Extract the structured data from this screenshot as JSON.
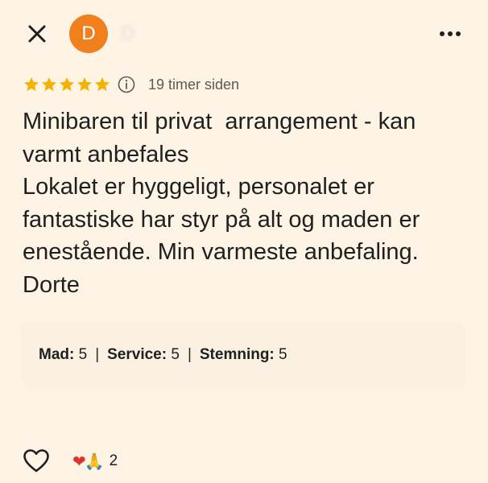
{
  "header": {
    "close_icon": "close-icon",
    "avatar_letter": "D",
    "avatar_color": "#f07f1d",
    "author_name": "D",
    "more_icon": "more-vertical-dots-icon"
  },
  "meta": {
    "rating": 5,
    "rating_max": 5,
    "star_color": "#f5b301",
    "info_icon": "info-icon",
    "time_ago": "19 timer siden"
  },
  "review": {
    "lines": [
      "Minibaren til privat  arrangement - kan",
      "varmt anbefales",
      "Lokalet er hyggeligt, personalet er",
      "fantastiske har styr på alt og maden er",
      "enestående. Min varmeste anbefaling.",
      "Dorte"
    ]
  },
  "ratings": [
    {
      "label": "Mad:",
      "value": "5"
    },
    {
      "label": "Service:",
      "value": "5"
    },
    {
      "label": "Stemning:",
      "value": "5"
    }
  ],
  "ratings_separator": "|",
  "footer": {
    "like_icon": "heart-outline-icon",
    "reaction_heart": "❤",
    "reaction_pray": "🙏",
    "reaction_count": "2"
  },
  "colors": {
    "background": "#fdf4e6",
    "text": "#1f1f1f",
    "muted": "#5f5a52"
  }
}
